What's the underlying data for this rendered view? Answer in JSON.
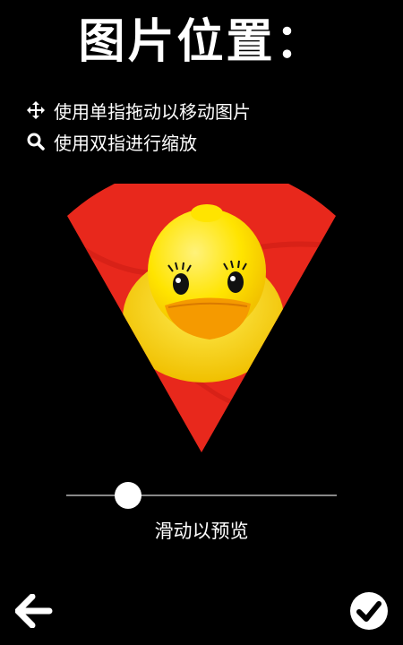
{
  "header": {
    "title": "图片位置："
  },
  "instructions": [
    {
      "icon": "move-arrows-icon",
      "text": "使用单指拖动以移动图片"
    },
    {
      "icon": "search-icon",
      "text": "使用双指进行缩放"
    }
  ],
  "slider": {
    "value_fraction": 0.23,
    "label": "滑动以预览"
  },
  "footer": {
    "back_icon": "arrow-left-icon",
    "confirm_icon": "check-circle-icon"
  },
  "colors": {
    "background": "#000000",
    "sector": "#e8281c",
    "duck": "#ffe400",
    "beak": "#f59a00"
  }
}
